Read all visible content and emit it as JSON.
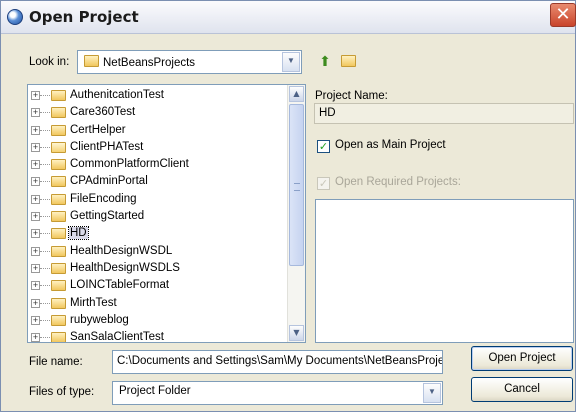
{
  "window": {
    "title": "Open Project",
    "close_icon": "close-icon"
  },
  "look_in": {
    "label": "Look in:",
    "value": "NetBeansProjects"
  },
  "toolbar": {
    "up_icon": "up-folder-icon",
    "new_folder_icon": "new-folder-icon"
  },
  "tree": {
    "items": [
      {
        "name": "AuthenitcationTest",
        "selected": false,
        "open_folder": false
      },
      {
        "name": "Care360Test",
        "selected": false,
        "open_folder": false
      },
      {
        "name": "CertHelper",
        "selected": false,
        "open_folder": false
      },
      {
        "name": "ClientPHATest",
        "selected": false,
        "open_folder": true
      },
      {
        "name": "CommonPlatformClient",
        "selected": false,
        "open_folder": false
      },
      {
        "name": "CPAdminPortal",
        "selected": false,
        "open_folder": false
      },
      {
        "name": "FileEncoding",
        "selected": false,
        "open_folder": false
      },
      {
        "name": "GettingStarted",
        "selected": false,
        "open_folder": false
      },
      {
        "name": "HD",
        "selected": true,
        "open_folder": false
      },
      {
        "name": "HealthDesignWSDL",
        "selected": false,
        "open_folder": false
      },
      {
        "name": "HealthDesignWSDLS",
        "selected": false,
        "open_folder": false
      },
      {
        "name": "LOINCTableFormat",
        "selected": false,
        "open_folder": false
      },
      {
        "name": "MirthTest",
        "selected": false,
        "open_folder": false
      },
      {
        "name": "rubyweblog",
        "selected": false,
        "open_folder": false
      },
      {
        "name": "SanSalaClientTest",
        "selected": false,
        "open_folder": false
      }
    ]
  },
  "project_name": {
    "label": "Project Name:",
    "value": "HD"
  },
  "open_as_main": {
    "label": "Open as Main Project",
    "checked": true
  },
  "open_required": {
    "label": "Open Required Projects:",
    "checked": true,
    "enabled": false
  },
  "file_name": {
    "label": "File name:",
    "value": "C:\\Documents and Settings\\Sam\\My Documents\\NetBeansProjects\\HD"
  },
  "files_of_type": {
    "label": "Files of type:",
    "value": "Project Folder"
  },
  "buttons": {
    "open": "Open Project",
    "cancel": "Cancel"
  },
  "colors": {
    "accent_border": "#7f9db9",
    "button_border": "#003c74",
    "dialog_bg": "#ece9d8"
  }
}
